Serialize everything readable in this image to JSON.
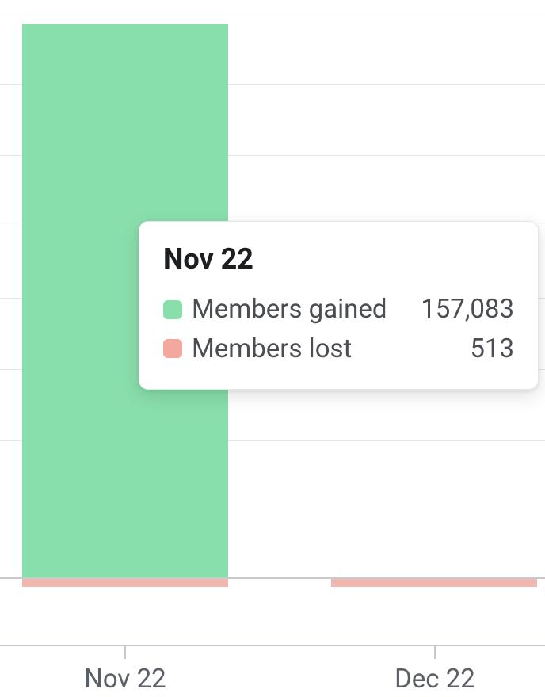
{
  "chart_data": {
    "type": "bar",
    "categories": [
      "Nov 22",
      "Dec 22"
    ],
    "series": [
      {
        "name": "Members gained",
        "values": [
          157083,
          null
        ],
        "color": "#89dfab"
      },
      {
        "name": "Members lost",
        "values": [
          513,
          null
        ],
        "color": "#f2a89f"
      }
    ],
    "xlabel": "",
    "ylabel": ""
  },
  "tooltip": {
    "title": "Nov 22",
    "rows": [
      {
        "label": "Members gained",
        "value": "157,083"
      },
      {
        "label": "Members lost",
        "value": "513"
      }
    ]
  },
  "axis": {
    "labels": [
      "Nov 22",
      "Dec 22"
    ]
  }
}
